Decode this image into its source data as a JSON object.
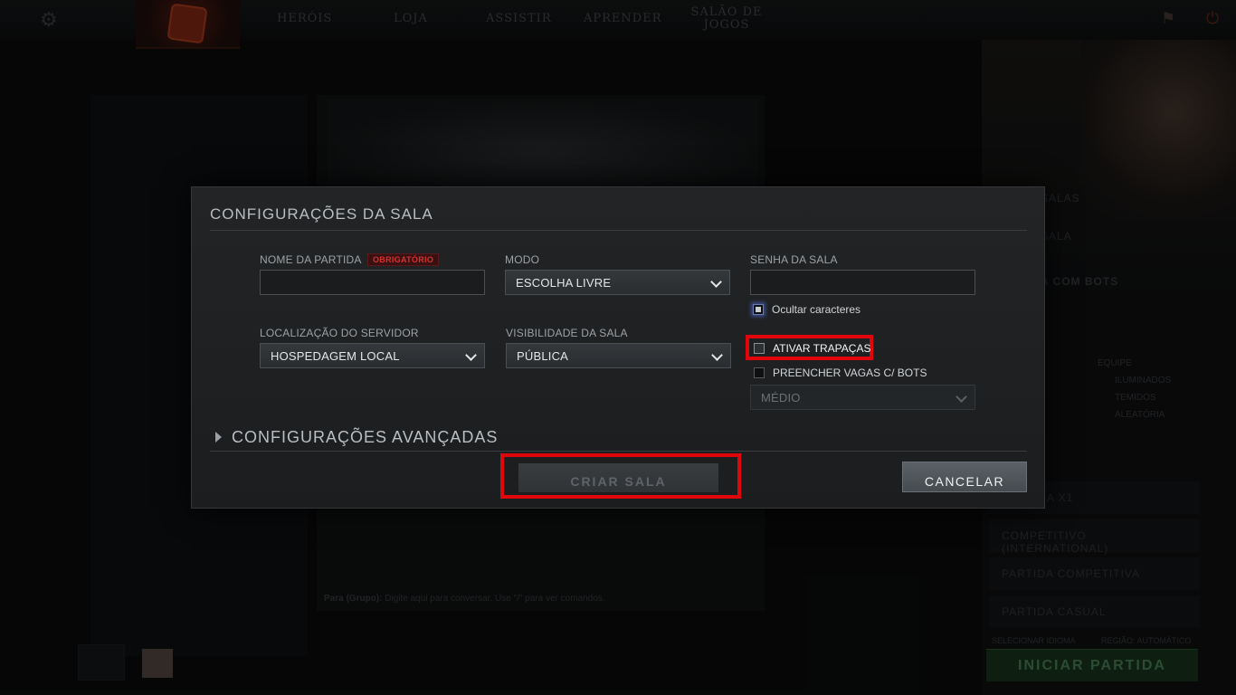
{
  "topnav": {
    "settings_icon": "gear-icon",
    "items": [
      "HERÓIS",
      "LOJA",
      "ASSISTIR",
      "APRENDER"
    ],
    "arcade": [
      "SALÃO DE",
      "JOGOS"
    ],
    "right_icons": [
      "trophy-icon",
      "power-icon"
    ]
  },
  "background": {
    "right_items": [
      "SALAS",
      "SALA",
      "A COM BOTS"
    ],
    "modes": [
      "A X1",
      "COMPETITIVO (INTERNATIONAL)",
      "PARTIDA COMPETITIVA",
      "PARTIDA CASUAL"
    ],
    "team_label": "EQUIPE",
    "teams": [
      "ILUMINADOS",
      "TEMIDOS",
      "ALEATÓRIA"
    ],
    "select_language": "SELECIONAR IDIOMA",
    "region": "REGIÃO: AUTOMÁTICO",
    "start_button": "INICIAR PARTIDA",
    "chat_prefix": "Para (Grupo):",
    "chat_placeholder": "Digite aqui para conversar. Use \"/\" para ver comandos."
  },
  "modal": {
    "title": "CONFIGURAÇÕES DA SALA",
    "match_name": {
      "label": "NOME DA PARTIDA",
      "badge": "OBRIGATÓRIO",
      "value": ""
    },
    "mode": {
      "label": "MODO",
      "value": "ESCOLHA LIVRE"
    },
    "password": {
      "label": "SENHA DA SALA",
      "value": ""
    },
    "hide_chars": {
      "label": "Ocultar caracteres",
      "checked": true
    },
    "server_location": {
      "label": "LOCALIZAÇÃO DO SERVIDOR",
      "value": "HOSPEDAGEM LOCAL"
    },
    "visibility": {
      "label": "VISIBILIDADE DA SALA",
      "value": "PÚBLICA"
    },
    "cheats": {
      "label": "ATIVAR TRAPAÇAS",
      "checked": false
    },
    "fill_bots": {
      "label": "PREENCHER VAGAS C/ BOTS",
      "checked": false
    },
    "bot_difficulty": {
      "value": "MÉDIO"
    },
    "advanced": "CONFIGURAÇÕES AVANÇADAS",
    "create_button": "CRIAR SALA",
    "cancel_button": "CANCELAR"
  }
}
